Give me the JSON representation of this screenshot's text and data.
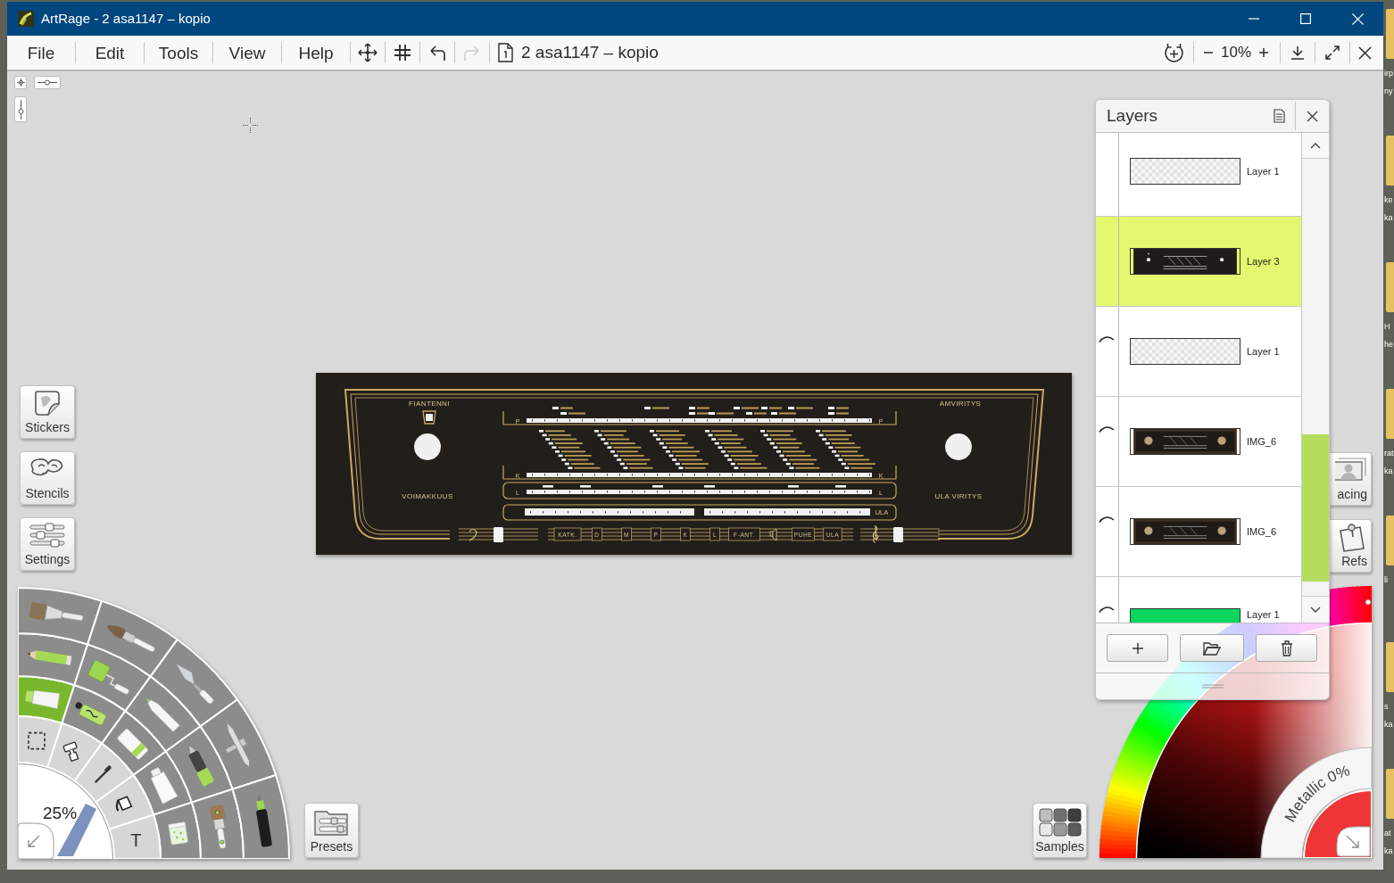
{
  "window": {
    "title": "ArtRage - 2 asa1147 – kopio"
  },
  "menu_bar": {
    "menus": [
      {
        "label": "File"
      },
      {
        "label": "Edit"
      },
      {
        "label": "Tools"
      },
      {
        "label": "View"
      },
      {
        "label": "Help"
      }
    ],
    "tools": [
      {
        "kind": "move",
        "disabled": false
      },
      {
        "kind": "grid",
        "disabled": false
      },
      {
        "kind": "undo",
        "disabled": false
      },
      {
        "kind": "redo",
        "disabled": true
      }
    ],
    "document_name": "2 asa1147 – kopio",
    "zoom": "10%"
  },
  "side_buttons": [
    {
      "kind": "stickers",
      "label": "Stickers"
    },
    {
      "kind": "stencils",
      "label": "Stencils"
    },
    {
      "kind": "settings",
      "label": "Settings"
    }
  ],
  "artwork": {
    "top_labels": [
      "FIANTENNI",
      "AMVIRITYS"
    ],
    "side_labels": [
      "VOIMAKKUUS",
      "ULA VIRITYS"
    ],
    "bands": [
      {
        "left": "P",
        "right": "P"
      },
      {
        "left": "K",
        "right": "K"
      },
      {
        "left": "L",
        "right": "L"
      }
    ],
    "fm_label": "ULA",
    "buttons": [
      {
        "kind": "text",
        "label": "KATK."
      },
      {
        "kind": "text",
        "label": "D"
      },
      {
        "kind": "text",
        "label": "M"
      },
      {
        "kind": "text",
        "label": "P"
      },
      {
        "kind": "text",
        "label": "K"
      },
      {
        "kind": "text",
        "label": "L"
      },
      {
        "kind": "text",
        "label": "F-ANT."
      },
      {
        "kind": "speaker"
      },
      {
        "kind": "text",
        "label": "PUHE"
      },
      {
        "kind": "text",
        "label": "ULA"
      }
    ]
  },
  "layers_panel": {
    "title": "Layers",
    "layers": [
      {
        "name": "Layer 1",
        "kind": "transparent",
        "hidden": false,
        "selected": false
      },
      {
        "name": "Layer 3",
        "kind": "dial",
        "hidden": false,
        "selected": true
      },
      {
        "name": "Layer 1",
        "kind": "transparent",
        "hidden": true,
        "selected": false
      },
      {
        "name": "IMG_6",
        "kind": "photo",
        "hidden": true,
        "selected": false
      },
      {
        "name": "IMG_6",
        "kind": "photo",
        "hidden": true,
        "selected": false
      },
      {
        "name": "Layer 1",
        "kind": "green",
        "hidden": true,
        "selected": false
      }
    ]
  },
  "right_buttons": [
    {
      "kind": "tracing",
      "label": "acing"
    },
    {
      "kind": "refs",
      "label": "Refs"
    }
  ],
  "tool_wheel": {
    "brush_size": "25%",
    "utility_tools": [
      {
        "kind": "select"
      },
      {
        "kind": "stamp"
      },
      {
        "kind": "eyedropper"
      },
      {
        "kind": "fill"
      },
      {
        "kind": "text",
        "label": "T"
      }
    ],
    "tools": [
      {
        "kind": "paint_tube",
        "selected": true
      },
      {
        "kind": "spray",
        "selected": false
      },
      {
        "kind": "eraser",
        "selected": false
      },
      {
        "kind": "tube",
        "selected": false
      },
      {
        "kind": "glitter",
        "selected": false
      },
      {
        "kind": "pencil",
        "selected": false
      },
      {
        "kind": "roller",
        "selected": false
      },
      {
        "kind": "marker",
        "selected": false
      },
      {
        "kind": "pen",
        "selected": false
      },
      {
        "kind": "oil_brush",
        "selected": false
      },
      {
        "kind": "flat_brush",
        "selected": false
      },
      {
        "kind": "round_brush",
        "selected": false
      },
      {
        "kind": "palette_knife",
        "selected": false
      },
      {
        "kind": "airbrush",
        "selected": false
      },
      {
        "kind": "fineliner",
        "selected": false
      }
    ]
  },
  "presets_button": {
    "label": "Presets"
  },
  "samples_button": {
    "label": "Samples"
  },
  "color_picker": {
    "metallic_label": "Metallic 0%"
  },
  "desktop": {
    "icons": [
      {
        "label_lines": [
          "irp",
          "ny"
        ]
      },
      {
        "label_lines": [
          "ke",
          "ka"
        ]
      },
      {
        "label_lines": [
          "H",
          "he"
        ]
      },
      {
        "label_lines": [
          "rat",
          "ka"
        ]
      },
      {
        "label_lines": [
          "li"
        ]
      },
      {
        "label_lines": [
          "s",
          "ka"
        ]
      },
      {
        "label_lines": [
          "at",
          "ka"
        ]
      }
    ]
  }
}
